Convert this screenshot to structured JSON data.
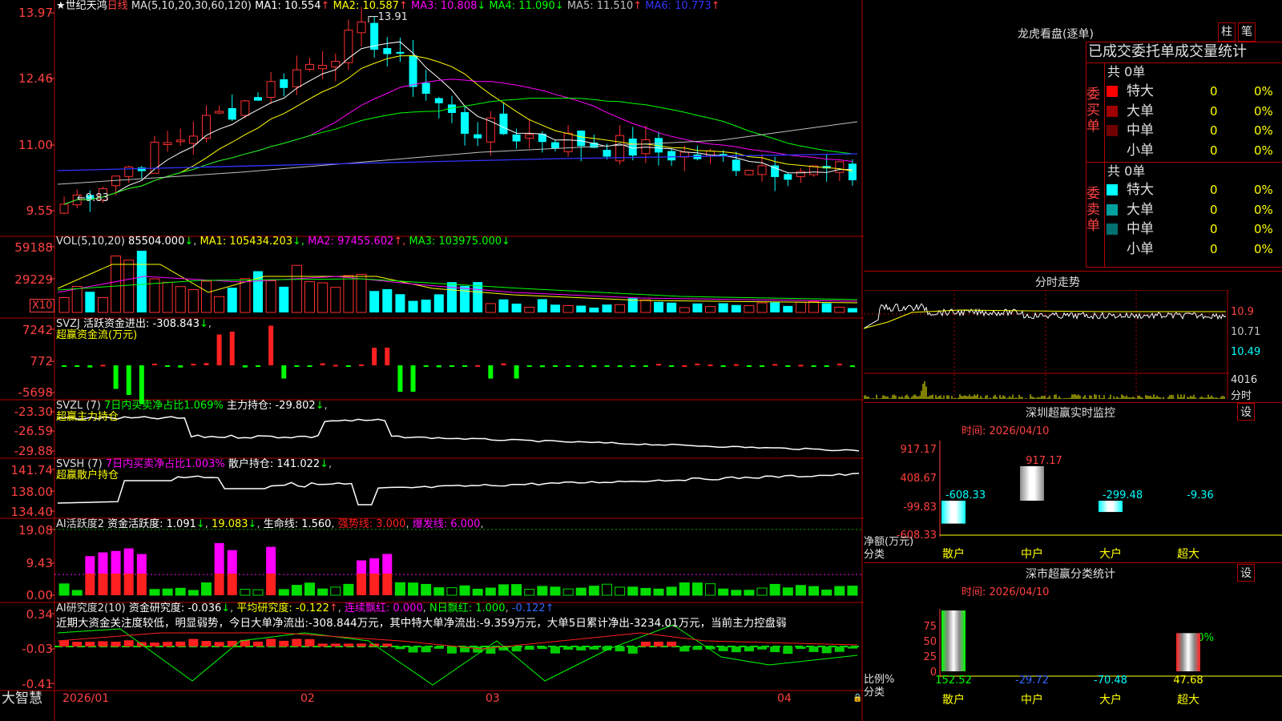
{
  "app": {
    "brand": "大智慧",
    "star": "★"
  },
  "main": {
    "stock_name": "世纪天鸿",
    "period": "日线",
    "ma_title": "MA(5,10,20,30,60,120)",
    "ma": [
      {
        "label": "MA1: 10.554",
        "arrow": "↑",
        "color": "#ffffff"
      },
      {
        "label": "MA2: 10.587",
        "arrow": "↑",
        "color": "#ffff00"
      },
      {
        "label": "MA3: 10.808",
        "arrow": "↓",
        "color": "#ff00ff"
      },
      {
        "label": "MA4: 11.090",
        "arrow": "↓",
        "color": "#00ff00"
      },
      {
        "label": "MA5: 11.510",
        "arrow": "↑",
        "color": "#c0c0c0"
      },
      {
        "label": "MA6: 10.773",
        "arrow": "↑",
        "color": "#3333ff"
      }
    ],
    "y_ticks": [
      "13.97",
      "12.46",
      "11.00",
      "9.55"
    ],
    "high_note": "13.91",
    "low_note": "9.83"
  },
  "vol": {
    "title": "VOL(5,10,20)",
    "value": "85504.000",
    "value_arrow": "↓",
    "ma": [
      {
        "label": "MA1: 105434.203",
        "arrow": "↓",
        "color": "#ffff00"
      },
      {
        "label": "MA2: 97455.602",
        "arrow": "↑",
        "color": "#ff00ff"
      },
      {
        "label": "MA3: 103975.000",
        "arrow": "↓",
        "color": "#00ff00"
      }
    ],
    "y_ticks": [
      "59188",
      "29229"
    ],
    "unit": "X10"
  },
  "svzj": {
    "title": "SVZJ",
    "label": "活跃资金进出: -308.843",
    "arrow": "↓",
    "subtitle": "超赢资金流(万元)",
    "y_ticks": [
      "7242",
      "772",
      "-5698"
    ]
  },
  "svzl": {
    "title": "SVZL (7)",
    "ratio": "7日内买卖净占比1.069%",
    "label": "主力持仓: -29.802",
    "arrow": "↓",
    "subtitle": "超赢主力持仓",
    "y_ticks": [
      "-23.30",
      "-26.59",
      "-29.88"
    ]
  },
  "svsh": {
    "title": "SVSH (7)",
    "ratio": "7日内买卖净占比1.003%",
    "label": "散户持仓: 141.022",
    "arrow": "↓",
    "subtitle": "超赢散户持仓",
    "y_ticks": [
      "141.74",
      "138.00",
      "134.40"
    ]
  },
  "ai2": {
    "title": "AI活跃度2",
    "label1": "资金活跃度: 1.091",
    "arrow1": "↓",
    "label2": "19.083",
    "arrow2": "↓",
    "label3": "生命线: 1.560",
    "label4": "强势线: 3.000",
    "label5": "爆发线: 6.000",
    "y_ticks": [
      "19.08",
      "9.43",
      "0.00"
    ]
  },
  "ai_res": {
    "title": "AI研究度2(10)",
    "label1": "资金研究度: -0.036",
    "arrow1": "↓",
    "label2": "平均研究度: -0.122",
    "arrow2": "↑",
    "label3": "连续飘红: 0.000",
    "label4": "N日飘红: 1.000",
    "label5": "-0.122",
    "arrow5": "↑",
    "y_ticks": [
      "0.34",
      "-0.03",
      "-0.41"
    ],
    "comment": "近期大资金关注度较低，明显弱势，今日大单净流出:-308.844万元，其中特大单净流出:-9.359万元，大单5日累计净出-3234.01万元，当前主力控盘弱"
  },
  "xaxis": [
    "2026/01",
    "02",
    "03",
    "04"
  ],
  "lhb": {
    "title": "龙虎看盘(逐单)",
    "btn_zhu": "柱",
    "btn_bi": "笔",
    "header": "已成交委托单成交量统计",
    "buy_label": "委买单",
    "sell_label": "委卖单",
    "buy_total": "共 0单",
    "sell_total": "共 0单",
    "buy_rows": [
      {
        "name": "特大",
        "count": "0",
        "pct": "0%",
        "color": "#ff0000"
      },
      {
        "name": "大单",
        "count": "0",
        "pct": "0%",
        "color": "#a00000"
      },
      {
        "name": "中单",
        "count": "0",
        "pct": "0%",
        "color": "#700000"
      },
      {
        "name": "小单",
        "count": "0",
        "pct": "0%",
        "color": "#000000"
      }
    ],
    "sell_rows": [
      {
        "name": "特大",
        "count": "0",
        "pct": "0%",
        "color": "#00ffff"
      },
      {
        "name": "大单",
        "count": "0",
        "pct": "0%",
        "color": "#00a0a0"
      },
      {
        "name": "中单",
        "count": "0",
        "pct": "0%",
        "color": "#007070"
      },
      {
        "name": "小单",
        "count": "0",
        "pct": "0%",
        "color": "#000000"
      }
    ]
  },
  "fenshi": {
    "title": "分时走势",
    "r1": "10.9",
    "r2": "10.71",
    "r3": "10.49",
    "vol": "4016",
    "vol_unit": "分时"
  },
  "monitor": {
    "title": "深圳超赢实时监控",
    "btn": "设",
    "time": "时间: 2026/04/10",
    "y_ticks": [
      "917.17",
      "408.67",
      "-99.83",
      "-608.33"
    ],
    "ylabel": "净额(万元)",
    "xlabel": "分类",
    "bars": [
      {
        "cat": "散户",
        "value": -608.33,
        "label": "-608.33",
        "label_color": "#00ffff"
      },
      {
        "cat": "中户",
        "value": 917.17,
        "label": "917.17",
        "label_color": "#ff4040"
      },
      {
        "cat": "大户",
        "value": -299.48,
        "label": "-299.48",
        "label_color": "#00ffff"
      },
      {
        "cat": "超大",
        "value": -9.36,
        "label": "-9.36",
        "label_color": "#00ffff"
      }
    ]
  },
  "fenlei": {
    "title": "深市超赢分类统计",
    "btn": "设",
    "time": "时间: 2026/04/10",
    "y_ticks": [
      "75",
      "50",
      "25",
      "0"
    ],
    "ylabel": "比例%",
    "xlabel": "分类",
    "top_note": "-0.00%",
    "bars": [
      {
        "cat": "散户",
        "value": 152.52,
        "label": "152.52",
        "label_color": "#00ff00"
      },
      {
        "cat": "中户",
        "value": -29.72,
        "label": "-29.72",
        "label_color": "#3366ff"
      },
      {
        "cat": "大户",
        "value": -70.48,
        "label": "-70.48",
        "label_color": "#00ffff"
      },
      {
        "cat": "超大",
        "value": 47.68,
        "label": "47.68",
        "label_color": "#ffff00"
      }
    ]
  },
  "chart_data": [
    {
      "type": "bar",
      "title": "深圳超赢实时监控",
      "categories": [
        "散户",
        "中户",
        "大户",
        "超大"
      ],
      "values": [
        -608.33,
        917.17,
        -299.48,
        -9.36
      ],
      "ylabel": "净额(万元)",
      "ylim": [
        -608.33,
        917.17
      ]
    },
    {
      "type": "bar",
      "title": "深市超赢分类统计",
      "categories": [
        "散户",
        "中户",
        "大户",
        "超大"
      ],
      "values": [
        152.52,
        -29.72,
        -70.48,
        47.68
      ],
      "ylabel": "比例%",
      "ylim": [
        0,
        75
      ]
    }
  ]
}
